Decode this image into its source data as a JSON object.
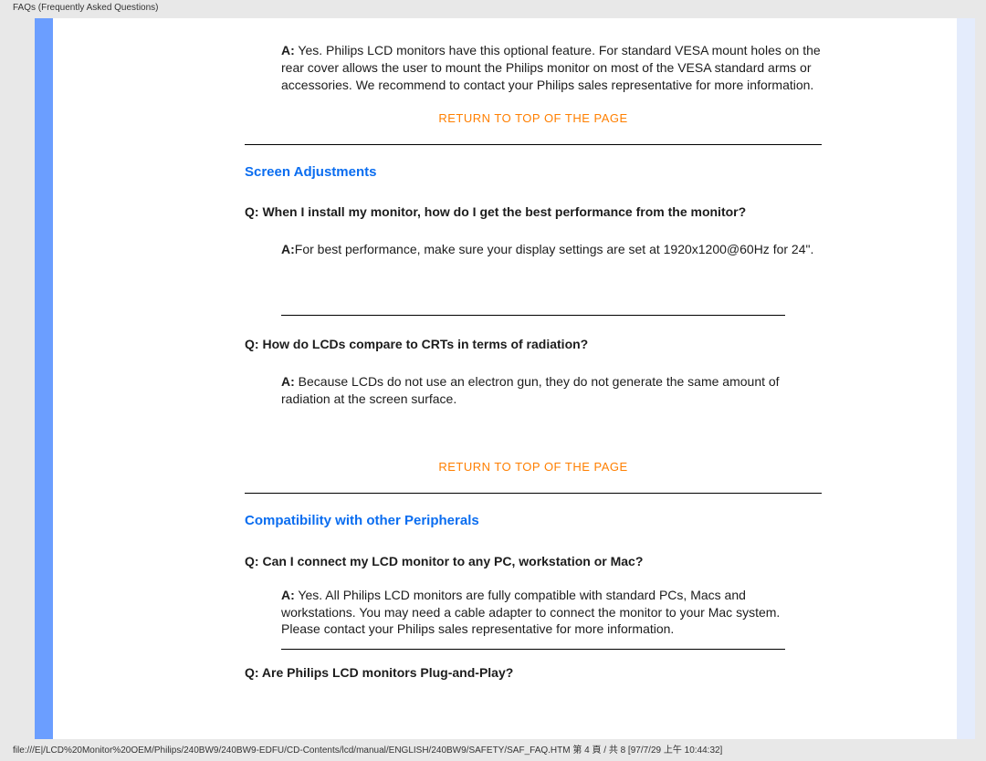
{
  "header": {
    "label": "FAQs (Frequently Asked Questions)"
  },
  "footer": {
    "text": "file:///E|/LCD%20Monitor%20OEM/Philips/240BW9/240BW9-EDFU/CD-Contents/lcd/manual/ENGLISH/240BW9/SAFETY/SAF_FAQ.HTM 第 4 頁 / 共 8 [97/7/29 上午 10:44:32]"
  },
  "nav": {
    "return_label": "RETURN TO TOP OF THE PAGE"
  },
  "labels": {
    "q": "Q:",
    "a": "A:"
  },
  "mount_answer": " Yes. Philips LCD monitors have this optional feature. For standard VESA mount holes on the rear cover allows the user to mount the Philips monitor on most of the VESA standard arms or accessories. We recommend to contact your Philips sales representative for more information.",
  "sections": {
    "screen_adjustments": {
      "title": "Screen Adjustments",
      "qa1": {
        "q": " When I install my monitor, how do I get the best performance from the monitor?",
        "a": "For best performance, make sure your display settings are set at 1920x1200@60Hz for 24\"."
      },
      "qa2": {
        "q": " How do LCDs compare to CRTs in terms of radiation?",
        "a": " Because LCDs do not use an electron gun, they do not generate the same amount of radiation at the screen surface."
      }
    },
    "compat": {
      "title": "Compatibility with other Peripherals",
      "qa1": {
        "q": " Can I connect my LCD monitor to any PC, workstation or Mac?",
        "a": " Yes. All Philips LCD monitors are fully compatible with standard PCs, Macs and workstations. You may need a cable adapter to connect the monitor to your Mac system. Please contact your Philips sales representative for more information."
      },
      "qa2": {
        "q": " Are Philips LCD monitors Plug-and-Play?"
      }
    }
  }
}
